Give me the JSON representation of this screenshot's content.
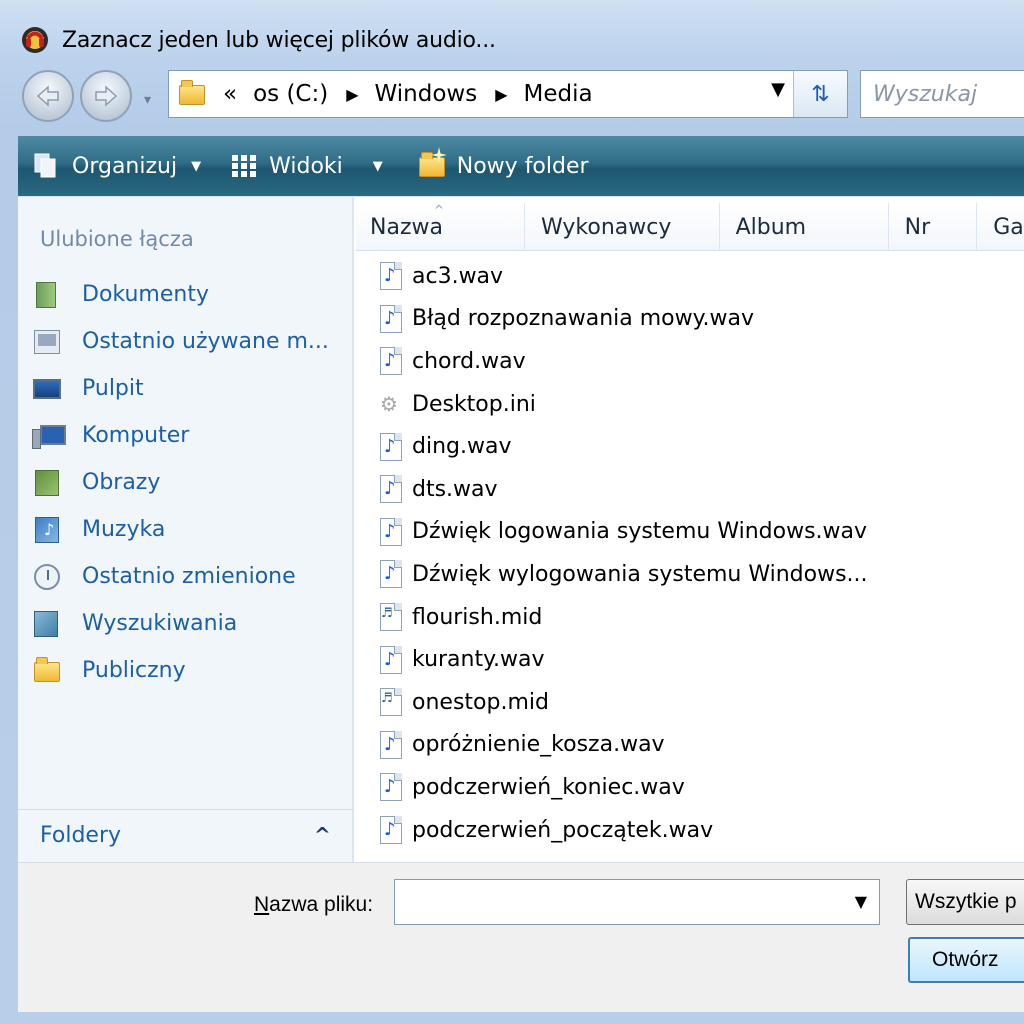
{
  "window": {
    "title": "Zaznacz jeden lub więcej plików audio..."
  },
  "address": {
    "overflow": "«",
    "crumbs": [
      "os (C:)",
      "Windows",
      "Media"
    ],
    "search_placeholder": "Wyszukaj"
  },
  "toolbar": {
    "organize_label": "Organizuj",
    "views_label": "Widoki",
    "new_folder_label": "Nowy folder"
  },
  "sidebar": {
    "heading": "Ulubione łącza",
    "items": [
      {
        "label": "Dokumenty",
        "icon": "documents-icon"
      },
      {
        "label": "Ostatnio używane m...",
        "icon": "recent-places-icon"
      },
      {
        "label": "Pulpit",
        "icon": "desktop-icon"
      },
      {
        "label": "Komputer",
        "icon": "computer-icon"
      },
      {
        "label": "Obrazy",
        "icon": "pictures-icon"
      },
      {
        "label": "Muzyka",
        "icon": "music-icon"
      },
      {
        "label": "Ostatnio zmienione",
        "icon": "recently-changed-icon"
      },
      {
        "label": "Wyszukiwania",
        "icon": "searches-icon"
      },
      {
        "label": "Publiczny",
        "icon": "public-folder-icon"
      }
    ],
    "folders_label": "Foldery",
    "folders_chevron": "^"
  },
  "columns": {
    "name": "Nazwa",
    "performers": "Wykonawcy",
    "album": "Album",
    "nr": "Nr",
    "genre": "Ga"
  },
  "files": [
    {
      "name": "ac3.wav",
      "type": "audio"
    },
    {
      "name": "Błąd rozpoznawania mowy.wav",
      "type": "audio"
    },
    {
      "name": "chord.wav",
      "type": "audio"
    },
    {
      "name": "Desktop.ini",
      "type": "settings"
    },
    {
      "name": "ding.wav",
      "type": "audio"
    },
    {
      "name": "dts.wav",
      "type": "audio"
    },
    {
      "name": "Dźwięk logowania systemu Windows.wav",
      "type": "audio"
    },
    {
      "name": "Dźwięk wylogowania systemu Windows...",
      "type": "audio"
    },
    {
      "name": "flourish.mid",
      "type": "midi"
    },
    {
      "name": "kuranty.wav",
      "type": "audio"
    },
    {
      "name": "onestop.mid",
      "type": "midi"
    },
    {
      "name": "opróżnienie_kosza.wav",
      "type": "audio"
    },
    {
      "name": "podczerwień_koniec.wav",
      "type": "audio"
    },
    {
      "name": "podczerwień_początek.wav",
      "type": "audio"
    }
  ],
  "bottom": {
    "filename_label_accel": "N",
    "filename_label_rest": "azwa pliku:",
    "filename_value": "",
    "filetype_label": "Wszytkie p",
    "open_label": "Otwórz"
  }
}
